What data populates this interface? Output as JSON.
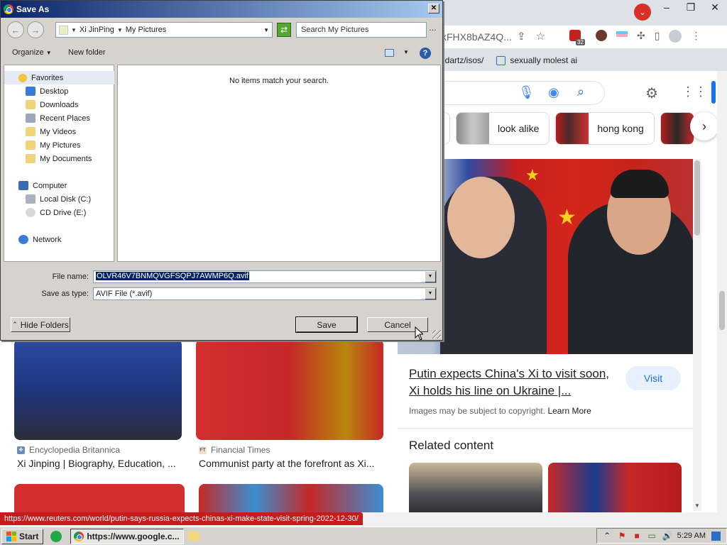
{
  "browser": {
    "url_fragment": "kFHX8bAZ4Q...",
    "ext_badge_count": "32",
    "bookmarks": [
      {
        "label": "edartz/isos/"
      },
      {
        "label": "sexually molest ai"
      }
    ],
    "search_chips": [
      {
        "label": "look alike"
      },
      {
        "label": "hong kong"
      }
    ],
    "preview": {
      "title": "Putin expects China's Xi to visit soon, Xi holds his line on Ukraine |...",
      "visit_label": "Visit",
      "copyright_text": "Images may be subject to copyright.",
      "learn_more": "Learn More",
      "related_heading": "Related content"
    },
    "results": [
      {
        "source": "Encyclopedia Britannica",
        "caption": "Xi Jinping | Biography, Education, ..."
      },
      {
        "source": "Financial Times",
        "caption": "Communist party at the forefront as Xi..."
      }
    ],
    "status_url": "https://www.reuters.com/world/putin-says-russia-expects-chinas-xi-make-state-visit-spring-2022-12-30/"
  },
  "dialog": {
    "title": "Save As",
    "address": {
      "seg1": "Xi JinPing",
      "seg2": "My Pictures"
    },
    "search_placeholder": "Search My Pictures",
    "toolbar": {
      "organize": "Organize",
      "new_folder": "New folder"
    },
    "nav": {
      "favorites": "Favorites",
      "items_fav": [
        "Desktop",
        "Downloads",
        "Recent Places",
        "My Videos",
        "My Pictures",
        "My Documents"
      ],
      "computer": "Computer",
      "items_comp": [
        "Local Disk (C:)",
        "CD Drive (E:)"
      ],
      "network": "Network"
    },
    "empty_message": "No items match your search.",
    "file_name_label": "File name:",
    "file_name_value": "OLVR46V7BNMQVGFSQPJ7AWMP6Q.avif",
    "save_type_label": "Save as type:",
    "save_type_value": "AVIF File (*.avif)",
    "hide_folders": "Hide Folders",
    "save": "Save",
    "cancel": "Cancel"
  },
  "taskbar": {
    "start": "Start",
    "task_label": "https://www.google.c...",
    "clock": "5:29 AM"
  }
}
